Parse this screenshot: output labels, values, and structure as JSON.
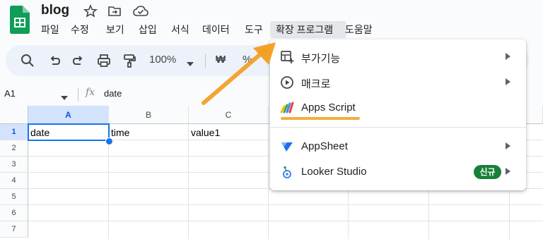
{
  "app": {
    "title": "blog",
    "icons": [
      "star-icon",
      "move-to-folder-icon",
      "cloud-saved-icon"
    ]
  },
  "menubar": {
    "items": [
      {
        "label": "파일",
        "key": "file"
      },
      {
        "label": "수정",
        "key": "edit"
      },
      {
        "label": "보기",
        "key": "view"
      },
      {
        "label": "삽입",
        "key": "insert"
      },
      {
        "label": "서식",
        "key": "format"
      },
      {
        "label": "데이터",
        "key": "data"
      },
      {
        "label": "도구",
        "key": "tools"
      },
      {
        "label": "확장 프로그램",
        "key": "extensions",
        "active": true
      },
      {
        "label": "도움말",
        "key": "help"
      }
    ]
  },
  "toolbar": {
    "zoom": "100%",
    "currency": "₩",
    "percent": "%",
    "icons": [
      "search-icon",
      "undo-icon",
      "redo-icon",
      "print-icon",
      "paint-format-icon",
      "zoom-dropdown-icon"
    ]
  },
  "formula_bar": {
    "cell_ref": "A1",
    "fx": "fx",
    "value": "date"
  },
  "sheet": {
    "columns": [
      "A",
      "B",
      "C"
    ],
    "rows": [
      "1",
      "2",
      "3",
      "4",
      "5",
      "6",
      "7"
    ],
    "cells": {
      "A1": "date",
      "B1": "time",
      "C1": "value1"
    },
    "selected_cell": "A1"
  },
  "extensions_menu": {
    "items": [
      {
        "label": "부가기능",
        "icon": "add-ons-icon",
        "submenu": true
      },
      {
        "label": "매크로",
        "icon": "macro-play-icon",
        "submenu": true
      },
      {
        "label": "Apps Script",
        "icon": "apps-script-icon",
        "submenu": false
      },
      {
        "label": "AppSheet",
        "icon": "appsheet-icon",
        "submenu": true
      },
      {
        "label": "Looker Studio",
        "icon": "looker-studio-icon",
        "submenu": true,
        "badge": "신규"
      }
    ]
  },
  "colors": {
    "accent": "#1a73e8",
    "annotation": "#f29d1f",
    "badge": "#188038"
  }
}
